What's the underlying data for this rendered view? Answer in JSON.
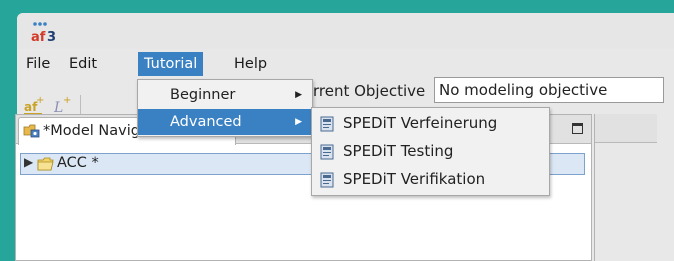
{
  "app": {
    "icon": "af3-logo-icon"
  },
  "menubar": {
    "items": [
      {
        "label": "File"
      },
      {
        "label": "Edit"
      },
      {
        "label": "Tutorial"
      },
      {
        "label": "Help"
      }
    ],
    "active": "Tutorial"
  },
  "toolbar": {
    "objective_label": "Current Objective",
    "objective_value": "No modeling objective",
    "icons": [
      "af-new-project-icon",
      "new-element-icon"
    ]
  },
  "tutorial_menu": {
    "items": [
      {
        "label": "Beginner",
        "has_submenu": true
      },
      {
        "label": "Advanced",
        "has_submenu": true
      }
    ],
    "highlighted": "Advanced"
  },
  "advanced_submenu": {
    "items": [
      {
        "label": "SPEDiT Verfeinerung",
        "icon": "document-icon"
      },
      {
        "label": "SPEDiT Testing",
        "icon": "document-icon"
      },
      {
        "label": "SPEDiT Verifikation",
        "icon": "document-icon"
      }
    ]
  },
  "navigator": {
    "tab_label": "*Model Navigator",
    "tab_close": "☒",
    "tree": [
      {
        "label": "ACC *",
        "icon": "folder-icon",
        "expanded": false
      }
    ]
  },
  "colors": {
    "desktop": "#26a69a",
    "accent": "#3a81c4",
    "selection": "#dbe7f5"
  }
}
